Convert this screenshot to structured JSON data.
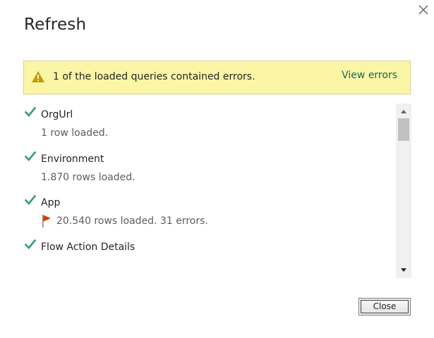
{
  "dialog": {
    "title": "Refresh",
    "close_icon": "close-icon"
  },
  "banner": {
    "icon": "warning-icon",
    "message": "1 of the loaded queries contained errors.",
    "link_label": "View errors",
    "background": "#fbf6a6",
    "link_color": "#106b57"
  },
  "queries": [
    {
      "name": "OrgUrl",
      "detail": "1 row loaded.",
      "status_icon": "check-icon",
      "has_errors": false
    },
    {
      "name": "Environment",
      "detail": "1.870 rows loaded.",
      "status_icon": "check-icon",
      "has_errors": false
    },
    {
      "name": "App",
      "detail": "20.540 rows loaded. 31 errors.",
      "status_icon": "check-icon",
      "has_errors": true,
      "error_icon": "flag-icon"
    },
    {
      "name": "Flow Action Details",
      "detail": "",
      "status_icon": "check-icon",
      "has_errors": false
    }
  ],
  "colors": {
    "check": "#3a9680",
    "flag": "#d83b01",
    "warning": "#c19c00"
  },
  "footer": {
    "close_label": "Close"
  }
}
